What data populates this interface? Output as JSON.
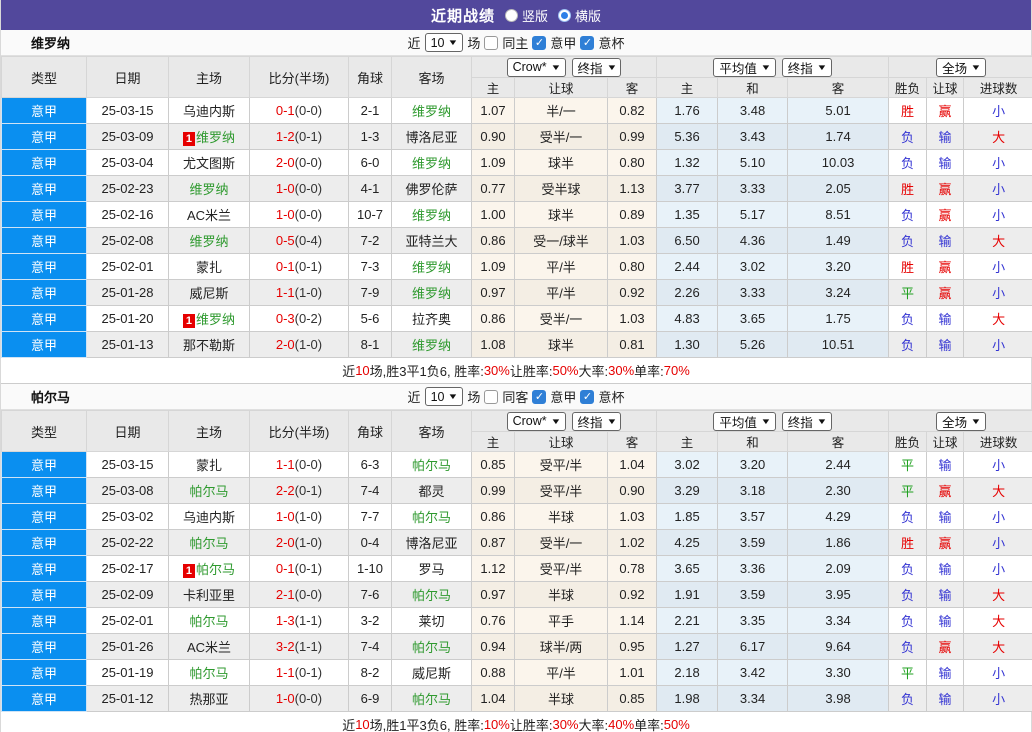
{
  "topbar": {
    "title": "近期战绩",
    "options": [
      {
        "label": "竖版",
        "selected": false
      },
      {
        "label": "横版",
        "selected": true
      }
    ]
  },
  "columns": {
    "type": "类型",
    "date": "日期",
    "home": "主场",
    "score": "比分(半场)",
    "corner": "角球",
    "away": "客场",
    "host": "主",
    "handicap": "让球",
    "guest": "客",
    "draw": "和",
    "result": "胜负",
    "goals": "进球数"
  },
  "controls": {
    "crow": "Crow*",
    "final": "终指",
    "average": "平均值",
    "full": "全场"
  },
  "badge": "1",
  "sections": [
    {
      "team": "维罗纳",
      "filter": {
        "near": "近",
        "count": "10",
        "games": "场",
        "same": "同主",
        "league": "意甲",
        "cup": "意杯",
        "same_checked": false,
        "league_checked": true,
        "cup_checked": true
      },
      "rows": [
        {
          "league": "意甲",
          "date": "25-03-15",
          "home": {
            "name": "乌迪内斯",
            "team": false,
            "badge": false
          },
          "score": {
            "ft": "0-1",
            "ht": "(0-0)"
          },
          "corner": "2-1",
          "away": {
            "name": "维罗纳",
            "team": true,
            "badge": false
          },
          "crow": [
            "1.07",
            "半/一",
            "0.82"
          ],
          "avg": [
            "1.76",
            "3.48",
            "5.01"
          ],
          "full": [
            "胜",
            "赢",
            "小"
          ]
        },
        {
          "league": "意甲",
          "date": "25-03-09",
          "home": {
            "name": "维罗纳",
            "team": true,
            "badge": true
          },
          "score": {
            "ft": "1-2",
            "ht": "(0-1)"
          },
          "corner": "1-3",
          "away": {
            "name": "博洛尼亚",
            "team": false,
            "badge": false
          },
          "crow": [
            "0.90",
            "受半/一",
            "0.99"
          ],
          "avg": [
            "5.36",
            "3.43",
            "1.74"
          ],
          "full": [
            "负",
            "输",
            "大"
          ]
        },
        {
          "league": "意甲",
          "date": "25-03-04",
          "home": {
            "name": "尤文图斯",
            "team": false,
            "badge": false
          },
          "score": {
            "ft": "2-0",
            "ht": "(0-0)"
          },
          "corner": "6-0",
          "away": {
            "name": "维罗纳",
            "team": true,
            "badge": false
          },
          "crow": [
            "1.09",
            "球半",
            "0.80"
          ],
          "avg": [
            "1.32",
            "5.10",
            "10.03"
          ],
          "full": [
            "负",
            "输",
            "小"
          ]
        },
        {
          "league": "意甲",
          "date": "25-02-23",
          "home": {
            "name": "维罗纳",
            "team": true,
            "badge": false
          },
          "score": {
            "ft": "1-0",
            "ht": "(0-0)"
          },
          "corner": "4-1",
          "away": {
            "name": "佛罗伦萨",
            "team": false,
            "badge": false
          },
          "crow": [
            "0.77",
            "受半球",
            "1.13"
          ],
          "avg": [
            "3.77",
            "3.33",
            "2.05"
          ],
          "full": [
            "胜",
            "赢",
            "小"
          ]
        },
        {
          "league": "意甲",
          "date": "25-02-16",
          "home": {
            "name": "AC米兰",
            "team": false,
            "badge": false
          },
          "score": {
            "ft": "1-0",
            "ht": "(0-0)"
          },
          "corner": "10-7",
          "away": {
            "name": "维罗纳",
            "team": true,
            "badge": false
          },
          "crow": [
            "1.00",
            "球半",
            "0.89"
          ],
          "avg": [
            "1.35",
            "5.17",
            "8.51"
          ],
          "full": [
            "负",
            "赢",
            "小"
          ]
        },
        {
          "league": "意甲",
          "date": "25-02-08",
          "home": {
            "name": "维罗纳",
            "team": true,
            "badge": false
          },
          "score": {
            "ft": "0-5",
            "ht": "(0-4)"
          },
          "corner": "7-2",
          "away": {
            "name": "亚特兰大",
            "team": false,
            "badge": false
          },
          "crow": [
            "0.86",
            "受一/球半",
            "1.03"
          ],
          "avg": [
            "6.50",
            "4.36",
            "1.49"
          ],
          "full": [
            "负",
            "输",
            "大"
          ]
        },
        {
          "league": "意甲",
          "date": "25-02-01",
          "home": {
            "name": "蒙扎",
            "team": false,
            "badge": false
          },
          "score": {
            "ft": "0-1",
            "ht": "(0-1)"
          },
          "corner": "7-3",
          "away": {
            "name": "维罗纳",
            "team": true,
            "badge": false
          },
          "crow": [
            "1.09",
            "平/半",
            "0.80"
          ],
          "avg": [
            "2.44",
            "3.02",
            "3.20"
          ],
          "full": [
            "胜",
            "赢",
            "小"
          ]
        },
        {
          "league": "意甲",
          "date": "25-01-28",
          "home": {
            "name": "威尼斯",
            "team": false,
            "badge": false
          },
          "score": {
            "ft": "1-1",
            "ht": "(1-0)"
          },
          "corner": "7-9",
          "away": {
            "name": "维罗纳",
            "team": true,
            "badge": false
          },
          "crow": [
            "0.97",
            "平/半",
            "0.92"
          ],
          "avg": [
            "2.26",
            "3.33",
            "3.24"
          ],
          "full": [
            "平",
            "赢",
            "小"
          ]
        },
        {
          "league": "意甲",
          "date": "25-01-20",
          "home": {
            "name": "维罗纳",
            "team": true,
            "badge": true
          },
          "score": {
            "ft": "0-3",
            "ht": "(0-2)"
          },
          "corner": "5-6",
          "away": {
            "name": "拉齐奥",
            "team": false,
            "badge": false
          },
          "crow": [
            "0.86",
            "受半/一",
            "1.03"
          ],
          "avg": [
            "4.83",
            "3.65",
            "1.75"
          ],
          "full": [
            "负",
            "输",
            "大"
          ]
        },
        {
          "league": "意甲",
          "date": "25-01-13",
          "home": {
            "name": "那不勒斯",
            "team": false,
            "badge": false
          },
          "score": {
            "ft": "2-0",
            "ht": "(1-0)"
          },
          "corner": "8-1",
          "away": {
            "name": "维罗纳",
            "team": true,
            "badge": false
          },
          "crow": [
            "1.08",
            "球半",
            "0.81"
          ],
          "avg": [
            "1.30",
            "5.26",
            "10.51"
          ],
          "full": [
            "负",
            "输",
            "小"
          ]
        }
      ],
      "summary": [
        {
          "t": "近",
          "r": false
        },
        {
          "t": "10",
          "r": true
        },
        {
          "t": "场,胜3平1负6, 胜率:",
          "r": false
        },
        {
          "t": "30%",
          "r": true
        },
        {
          "t": " 让胜率:",
          "r": false
        },
        {
          "t": "50%",
          "r": true
        },
        {
          "t": " 大率:",
          "r": false
        },
        {
          "t": "30%",
          "r": true
        },
        {
          "t": " 单率:",
          "r": false
        },
        {
          "t": "70%",
          "r": true
        }
      ]
    },
    {
      "team": "帕尔马",
      "filter": {
        "near": "近",
        "count": "10",
        "games": "场",
        "same": "同客",
        "league": "意甲",
        "cup": "意杯",
        "same_checked": false,
        "league_checked": true,
        "cup_checked": true
      },
      "rows": [
        {
          "league": "意甲",
          "date": "25-03-15",
          "home": {
            "name": "蒙扎",
            "team": false,
            "badge": false
          },
          "score": {
            "ft": "1-1",
            "ht": "(0-0)"
          },
          "corner": "6-3",
          "away": {
            "name": "帕尔马",
            "team": true,
            "badge": false
          },
          "crow": [
            "0.85",
            "受平/半",
            "1.04"
          ],
          "avg": [
            "3.02",
            "3.20",
            "2.44"
          ],
          "full": [
            "平",
            "输",
            "小"
          ]
        },
        {
          "league": "意甲",
          "date": "25-03-08",
          "home": {
            "name": "帕尔马",
            "team": true,
            "badge": false
          },
          "score": {
            "ft": "2-2",
            "ht": "(0-1)"
          },
          "corner": "7-4",
          "away": {
            "name": "都灵",
            "team": false,
            "badge": false
          },
          "crow": [
            "0.99",
            "受平/半",
            "0.90"
          ],
          "avg": [
            "3.29",
            "3.18",
            "2.30"
          ],
          "full": [
            "平",
            "赢",
            "大"
          ]
        },
        {
          "league": "意甲",
          "date": "25-03-02",
          "home": {
            "name": "乌迪内斯",
            "team": false,
            "badge": false
          },
          "score": {
            "ft": "1-0",
            "ht": "(1-0)"
          },
          "corner": "7-7",
          "away": {
            "name": "帕尔马",
            "team": true,
            "badge": false
          },
          "crow": [
            "0.86",
            "半球",
            "1.03"
          ],
          "avg": [
            "1.85",
            "3.57",
            "4.29"
          ],
          "full": [
            "负",
            "输",
            "小"
          ]
        },
        {
          "league": "意甲",
          "date": "25-02-22",
          "home": {
            "name": "帕尔马",
            "team": true,
            "badge": false
          },
          "score": {
            "ft": "2-0",
            "ht": "(1-0)"
          },
          "corner": "0-4",
          "away": {
            "name": "博洛尼亚",
            "team": false,
            "badge": false
          },
          "crow": [
            "0.87",
            "受半/一",
            "1.02"
          ],
          "avg": [
            "4.25",
            "3.59",
            "1.86"
          ],
          "full": [
            "胜",
            "赢",
            "小"
          ]
        },
        {
          "league": "意甲",
          "date": "25-02-17",
          "home": {
            "name": "帕尔马",
            "team": true,
            "badge": true
          },
          "score": {
            "ft": "0-1",
            "ht": "(0-1)"
          },
          "corner": "1-10",
          "away": {
            "name": "罗马",
            "team": false,
            "badge": false
          },
          "crow": [
            "1.12",
            "受平/半",
            "0.78"
          ],
          "avg": [
            "3.65",
            "3.36",
            "2.09"
          ],
          "full": [
            "负",
            "输",
            "小"
          ]
        },
        {
          "league": "意甲",
          "date": "25-02-09",
          "home": {
            "name": "卡利亚里",
            "team": false,
            "badge": false
          },
          "score": {
            "ft": "2-1",
            "ht": "(0-0)"
          },
          "corner": "7-6",
          "away": {
            "name": "帕尔马",
            "team": true,
            "badge": false
          },
          "crow": [
            "0.97",
            "半球",
            "0.92"
          ],
          "avg": [
            "1.91",
            "3.59",
            "3.95"
          ],
          "full": [
            "负",
            "输",
            "大"
          ]
        },
        {
          "league": "意甲",
          "date": "25-02-01",
          "home": {
            "name": "帕尔马",
            "team": true,
            "badge": false
          },
          "score": {
            "ft": "1-3",
            "ht": "(1-1)"
          },
          "corner": "3-2",
          "away": {
            "name": "莱切",
            "team": false,
            "badge": false
          },
          "crow": [
            "0.76",
            "平手",
            "1.14"
          ],
          "avg": [
            "2.21",
            "3.35",
            "3.34"
          ],
          "full": [
            "负",
            "输",
            "大"
          ]
        },
        {
          "league": "意甲",
          "date": "25-01-26",
          "home": {
            "name": "AC米兰",
            "team": false,
            "badge": false
          },
          "score": {
            "ft": "3-2",
            "ht": "(1-1)"
          },
          "corner": "7-4",
          "away": {
            "name": "帕尔马",
            "team": true,
            "badge": false
          },
          "crow": [
            "0.94",
            "球半/两",
            "0.95"
          ],
          "avg": [
            "1.27",
            "6.17",
            "9.64"
          ],
          "full": [
            "负",
            "赢",
            "大"
          ]
        },
        {
          "league": "意甲",
          "date": "25-01-19",
          "home": {
            "name": "帕尔马",
            "team": true,
            "badge": false
          },
          "score": {
            "ft": "1-1",
            "ht": "(0-1)"
          },
          "corner": "8-2",
          "away": {
            "name": "威尼斯",
            "team": false,
            "badge": false
          },
          "crow": [
            "0.88",
            "平/半",
            "1.01"
          ],
          "avg": [
            "2.18",
            "3.42",
            "3.30"
          ],
          "full": [
            "平",
            "输",
            "小"
          ]
        },
        {
          "league": "意甲",
          "date": "25-01-12",
          "home": {
            "name": "热那亚",
            "team": false,
            "badge": false
          },
          "score": {
            "ft": "1-0",
            "ht": "(0-0)"
          },
          "corner": "6-9",
          "away": {
            "name": "帕尔马",
            "team": true,
            "badge": false
          },
          "crow": [
            "1.04",
            "半球",
            "0.85"
          ],
          "avg": [
            "1.98",
            "3.34",
            "3.98"
          ],
          "full": [
            "负",
            "输",
            "小"
          ]
        }
      ],
      "summary": [
        {
          "t": "近",
          "r": false
        },
        {
          "t": "10",
          "r": true
        },
        {
          "t": "场,胜1平3负6, 胜率:",
          "r": false
        },
        {
          "t": "10%",
          "r": true
        },
        {
          "t": " 让胜率:",
          "r": false
        },
        {
          "t": "30%",
          "r": true
        },
        {
          "t": " 大率:",
          "r": false
        },
        {
          "t": "40%",
          "r": true
        },
        {
          "t": " 单率:",
          "r": false
        },
        {
          "t": "50%",
          "r": true
        }
      ]
    }
  ]
}
